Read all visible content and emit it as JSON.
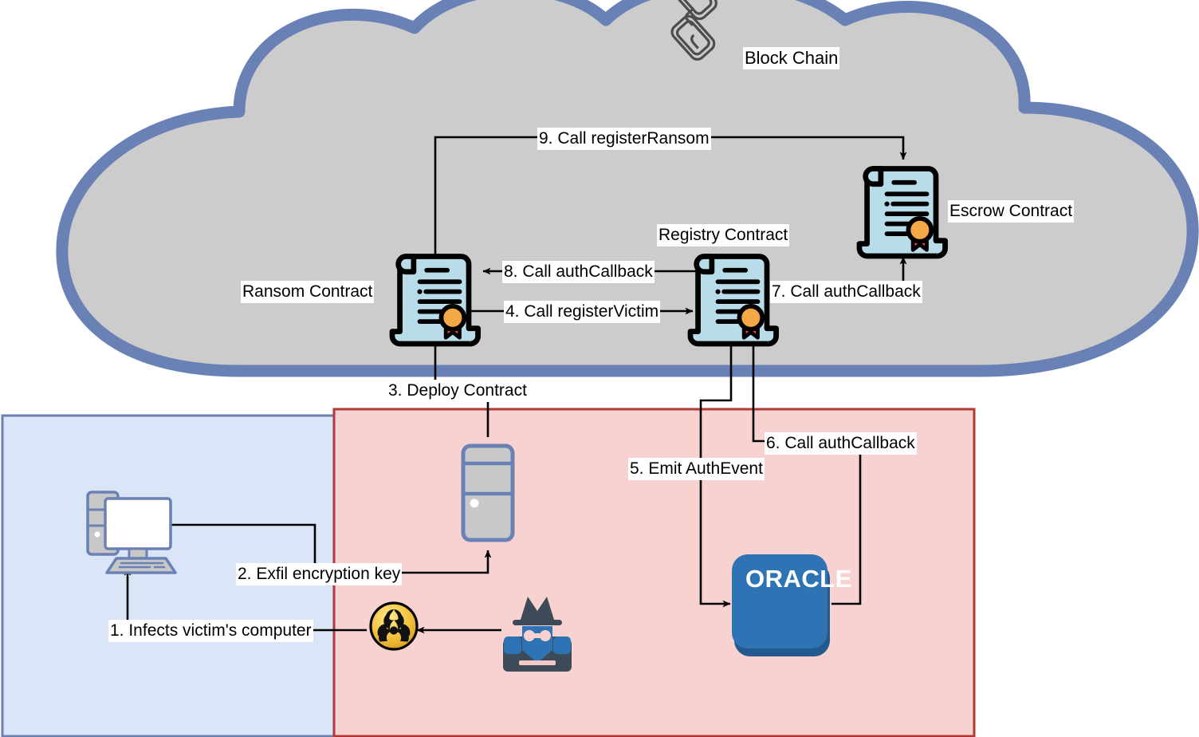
{
  "diagram": {
    "title_label": "Block Chain",
    "cloud": {
      "fill": "#cccccc",
      "stroke": "#6a81b6",
      "label": "Block Chain",
      "icon": "blockchain-link-icon"
    },
    "zones": [
      {
        "name": "victim-zone",
        "fill": "#dae5f7",
        "stroke": "#6a81b6"
      },
      {
        "name": "attacker-zone",
        "fill": "#f8d2d0",
        "stroke": "#b03a35"
      }
    ],
    "nodes": [
      {
        "id": "ransom-contract",
        "label": "Ransom Contract",
        "icon": "contract-scroll-icon"
      },
      {
        "id": "registry-contract",
        "label": "Registry Contract",
        "icon": "contract-scroll-icon"
      },
      {
        "id": "escrow-contract",
        "label": "Escrow Contract",
        "icon": "contract-scroll-icon"
      },
      {
        "id": "victim-computer",
        "label": "",
        "icon": "desktop-computer-icon"
      },
      {
        "id": "attacker-server",
        "label": "",
        "icon": "server-tower-icon"
      },
      {
        "id": "ransomware",
        "label": "",
        "icon": "biohazard-icon"
      },
      {
        "id": "attacker",
        "label": "",
        "icon": "hacker-icon"
      },
      {
        "id": "oracle",
        "label": "ORACLE",
        "icon": "oracle-box",
        "fill": "#2e74b5",
        "shadow": "#225a8f"
      }
    ],
    "steps": [
      {
        "n": 1,
        "label": "1. Infects victim's computer",
        "from": "ransomware",
        "to": "victim-computer"
      },
      {
        "n": 2,
        "label": "2. Exfil encryption key",
        "from": "victim-computer",
        "to": "attacker-server"
      },
      {
        "n": 3,
        "label": "3. Deploy Contract",
        "from": "attacker-server",
        "to": "ransom-contract"
      },
      {
        "n": 4,
        "label": "4. Call registerVictim",
        "from": "ransom-contract",
        "to": "registry-contract"
      },
      {
        "n": 5,
        "label": "5. Emit AuthEvent",
        "from": "registry-contract",
        "to": "oracle"
      },
      {
        "n": 6,
        "label": "6. Call authCallback",
        "from": "oracle",
        "to": "registry-contract"
      },
      {
        "n": 7,
        "label": "7. Call authCallback",
        "from": "registry-contract",
        "to": "escrow-contract"
      },
      {
        "n": 8,
        "label": "8. Call authCallback",
        "from": "registry-contract",
        "to": "ransom-contract"
      },
      {
        "n": 9,
        "label": "9. Call registerRansom",
        "from": "ransom-contract",
        "to": "escrow-contract"
      }
    ],
    "oracle_label": "ORACLE"
  }
}
